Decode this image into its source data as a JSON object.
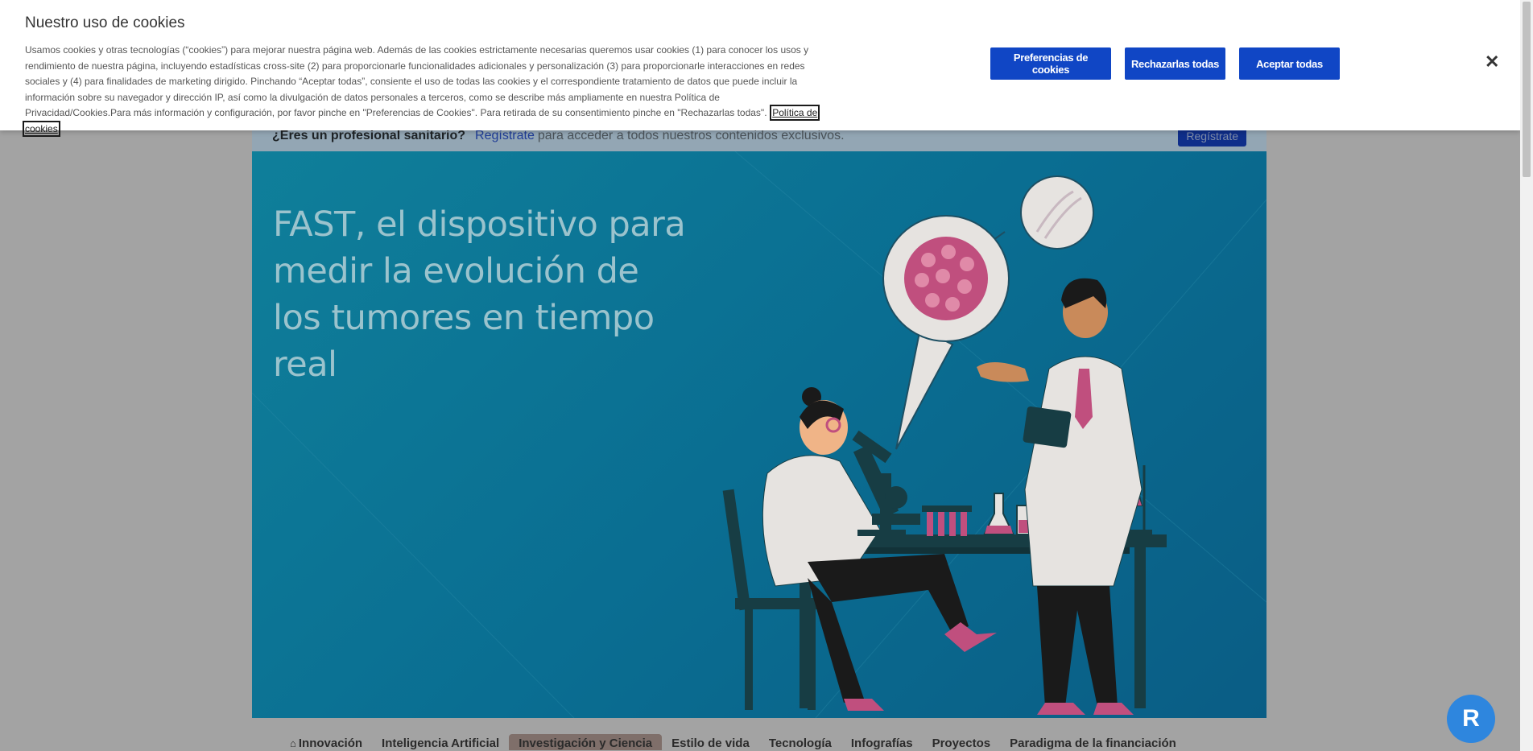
{
  "cookie_banner": {
    "title": "Nuestro uso de cookies",
    "text": "Usamos cookies y otras tecnologías (“cookies”) para mejorar nuestra página web. Además de las cookies estrictamente necesarias queremos usar cookies (1) para conocer los usos y rendimiento de nuestra página, incluyendo estadísticas cross-site (2) para proporcionarle funcionalidades adicionales y personalización (3) para proporcionarle interacciones en redes sociales y (4) para finalidades de marketing dirigido. Pinchando “Aceptar todas”, consiente el uso de todas las cookies y el correspondiente tratamiento de datos que puede incluir la información sobre su navegador y dirección IP, así como la divulgación de datos personales a terceros, como se describe más ampliamente en nuestra Política de Privacidad/Cookies.Para más información y configuración, por favor pinche en \"Preferencias de Cookies\". Para retirada de su consentimiento pinche en \"Rechazarlas todas\".",
    "policy_link": "Política de cookies",
    "btn_preferences": "Preferencias de cookies",
    "btn_reject": "Rechazarlas todas",
    "btn_accept": "Aceptar todas",
    "close": "✕"
  },
  "register_bar": {
    "question": "¿Eres un profesional sanitario?",
    "link": "Regístrate",
    "text": "para acceder a todos nuestros contenidos exclusivos.",
    "button": "Regístrate"
  },
  "hero": {
    "title": "FAST, el dispositivo para medir la evolución de los tumores en tiempo real"
  },
  "nav": {
    "items": [
      {
        "label": "Innovación",
        "icon": "home-icon"
      },
      {
        "label": "Inteligencia Artificial"
      },
      {
        "label": "Investigación y Ciencia",
        "active": true
      },
      {
        "label": "Estilo de vida"
      },
      {
        "label": "Tecnología"
      },
      {
        "label": "Infografías"
      },
      {
        "label": "Proyectos"
      },
      {
        "label": "Paradigma de la financiación"
      }
    ]
  },
  "colors": {
    "primary_button": "#1046c5",
    "hero_bg": "#0a6e92"
  }
}
